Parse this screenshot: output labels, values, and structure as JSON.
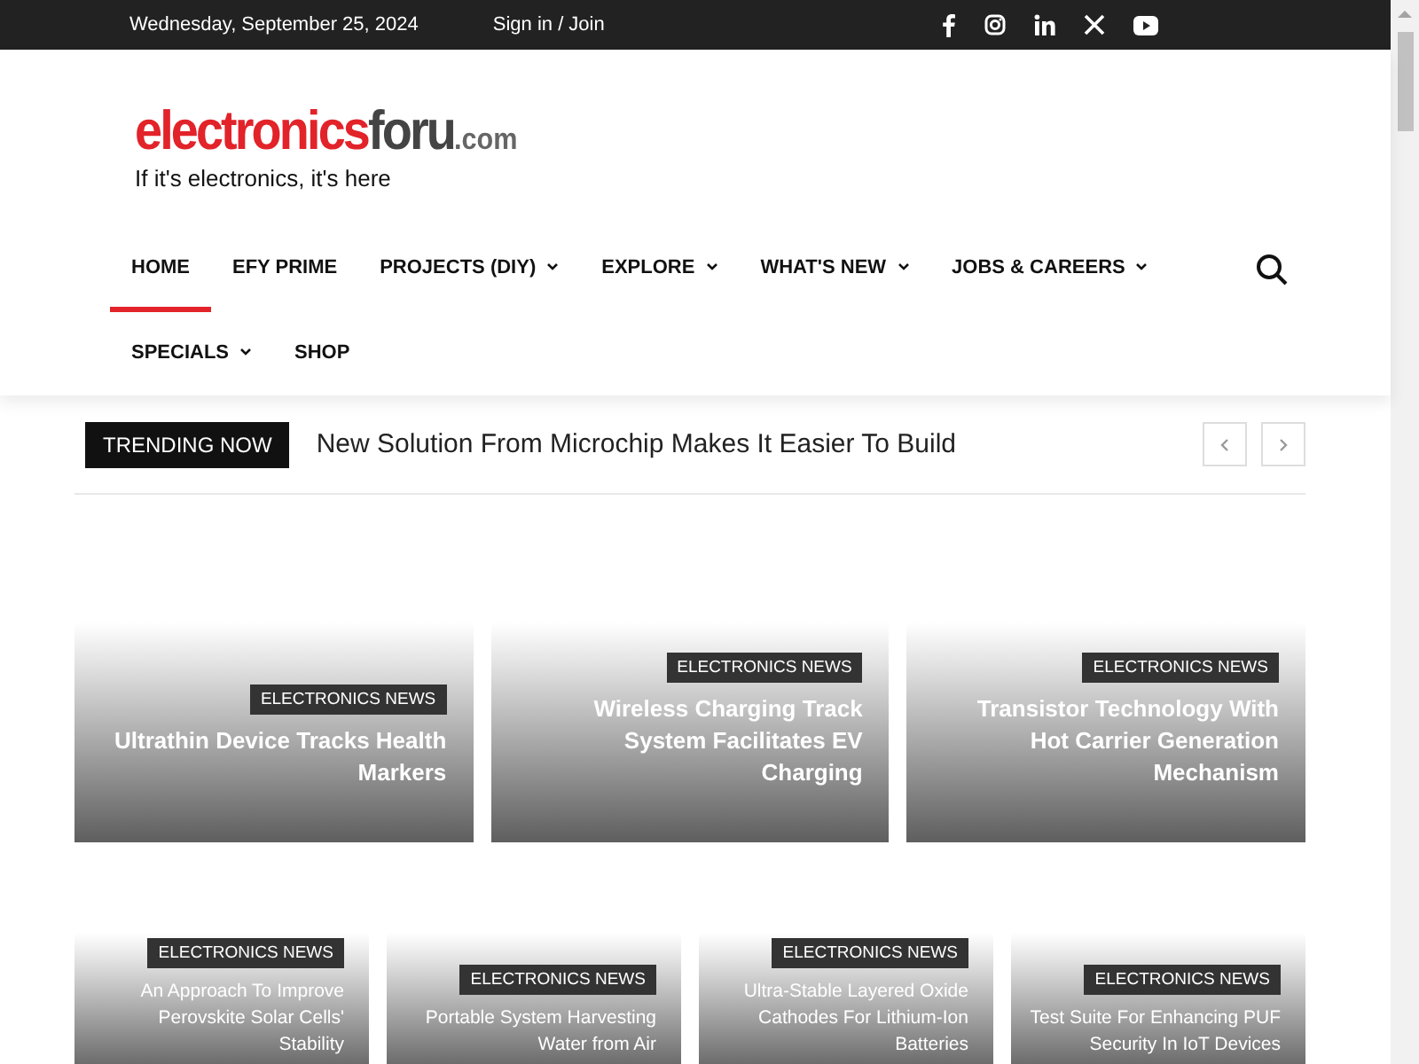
{
  "top_bar": {
    "date": "Wednesday, September 25, 2024",
    "sign_in": "Sign in / Join"
  },
  "logo": {
    "brand_red": "electronics",
    "brand_dark": "foru",
    "domain": ".com",
    "tagline": "If it's electronics, it's here"
  },
  "nav": [
    {
      "label": "HOME",
      "selected": true,
      "has_dropdown": false
    },
    {
      "label": "EFY PRIME",
      "selected": false,
      "has_dropdown": false
    },
    {
      "label": "PROJECTS (DIY)",
      "selected": false,
      "has_dropdown": true
    },
    {
      "label": "EXPLORE",
      "selected": false,
      "has_dropdown": true
    },
    {
      "label": "WHAT'S NEW",
      "selected": false,
      "has_dropdown": true
    },
    {
      "label": "JOBS & CAREERS",
      "selected": false,
      "has_dropdown": true
    },
    {
      "label": "SPECIALS",
      "selected": false,
      "has_dropdown": true
    },
    {
      "label": "SHOP",
      "selected": false,
      "has_dropdown": false
    }
  ],
  "trending": {
    "label": "TRENDING NOW",
    "headline": "New Solution From Microchip Makes It Easier To Build"
  },
  "featured": [
    {
      "category": "ELECTRONICS NEWS",
      "title": "Ultrathin Device Tracks Health Markers"
    },
    {
      "category": "ELECTRONICS NEWS",
      "title": "Wireless Charging Track System Facilitates EV Charging"
    },
    {
      "category": "ELECTRONICS NEWS",
      "title": "Transistor Technology With Hot Carrier Generation Mechanism"
    }
  ],
  "latest": [
    {
      "category": "ELECTRONICS NEWS",
      "title": "An Approach To Improve Perovskite Solar Cells' Stability"
    },
    {
      "category": "ELECTRONICS NEWS",
      "title": "Portable System Harvesting Water from Air"
    },
    {
      "category": "ELECTRONICS NEWS",
      "title": "Ultra-Stable Layered Oxide Cathodes For Lithium-Ion Batteries"
    },
    {
      "category": "ELECTRONICS NEWS",
      "title": "Test Suite For Enhancing PUF Security In IoT Devices"
    }
  ]
}
